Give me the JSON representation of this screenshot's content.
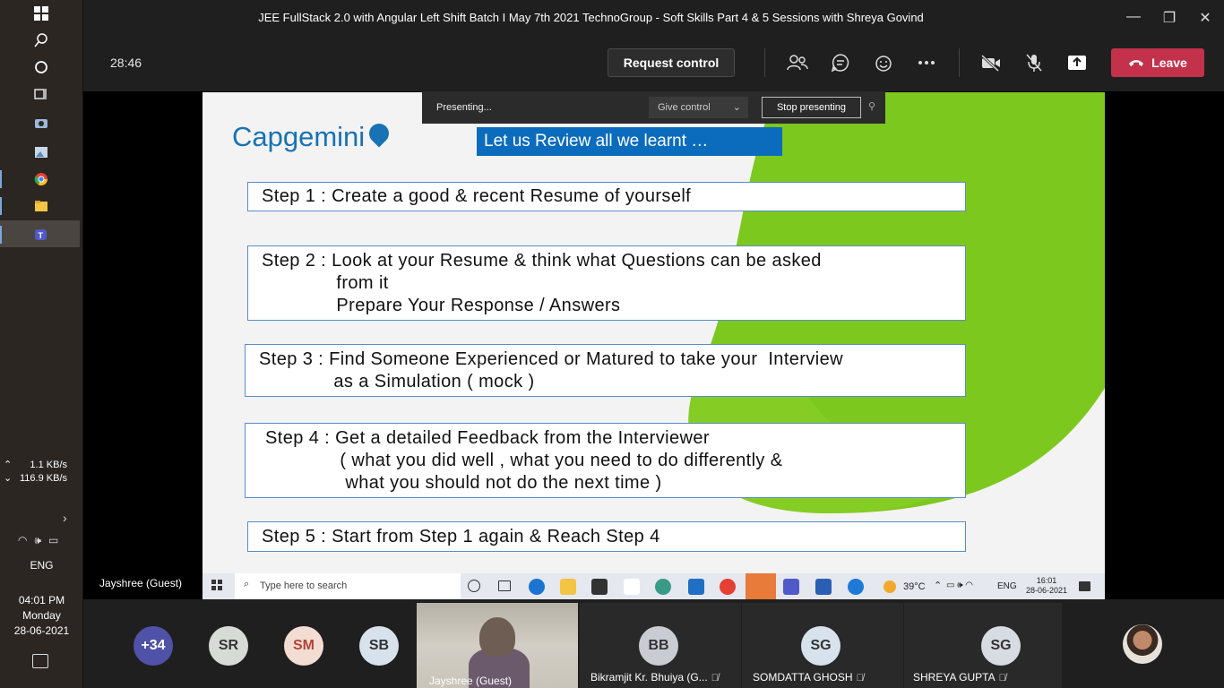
{
  "window": {
    "title": "JEE FullStack 2.0 with Angular Left Shift Batch I May 7th 2021 TechnoGroup - Soft Skills Part 4 & 5 Sessions with Shreya Govind",
    "minimize": "—",
    "maximize": "❐",
    "close": "✕"
  },
  "meeting": {
    "timer": "28:46",
    "request_control": "Request control",
    "leave": "Leave",
    "presenter_name": "Jayshree (Guest)"
  },
  "presenting_bar": {
    "status": "Presenting...",
    "give_control": "Give control",
    "stop_presenting": "Stop presenting"
  },
  "slide": {
    "logo": "Capgemini",
    "heading": "Let us Review all we learnt …",
    "steps": [
      "Step 1 : Create a good & recent Resume of yourself",
      "Step 2 : Look at your Resume & think what Questions can be asked\n              from it\n              Prepare Your Response / Answers",
      "Step 3 : Find Someone Experienced or Matured to take your  Interview\n              as a Simulation ( mock )",
      "Step 4 : Get a detailed Feedback from the Interviewer\n              ( what you did well , what you need to do differently &\n               what you should not do the next time )",
      "Step 5 : Start from Step 1 again & Reach Step 4"
    ]
  },
  "inner_taskbar": {
    "search_placeholder": "Type here to search",
    "weather": "39°C",
    "lang": "ENG",
    "time": "16:01",
    "date": "28-06-2021"
  },
  "system": {
    "upload_speed": "1.1 KB/s",
    "download_speed": "116.9 KB/s",
    "language": "ENG",
    "time": "04:01 PM",
    "day": "Monday",
    "date": "28-06-2021"
  },
  "participants": {
    "more_count": "+34",
    "initials": [
      "SR",
      "SM",
      "SB"
    ],
    "video_name": "Jayshree (Guest)",
    "tiles": [
      {
        "initials": "BB",
        "name": "Bikramjit Kr. Bhuiya (G..."
      },
      {
        "initials": "SG",
        "name": "SOMDATTA GHOSH"
      },
      {
        "initials": "SG",
        "name": "SHREYA GUPTA"
      }
    ]
  },
  "colors": {
    "leave": "#c4314b",
    "heading_bg": "#0b6cbd",
    "slide_green": "#7dc81e",
    "logo": "#1872b4"
  }
}
